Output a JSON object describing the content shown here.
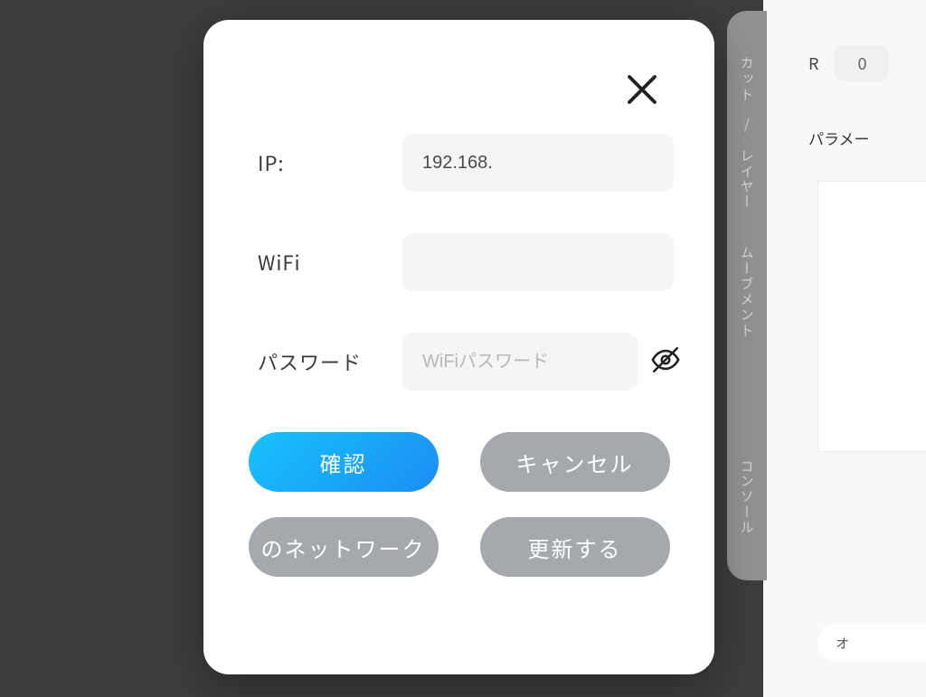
{
  "background": {
    "tabs": [
      "カット / レイヤー",
      "ムーブメント",
      "コンソール"
    ],
    "r_label": "R",
    "r_value": "0",
    "param_label": "パラメー",
    "pill_text": "オ"
  },
  "modal": {
    "fields": {
      "ip": {
        "label": "IP:",
        "value": "192.168.",
        "placeholder": ""
      },
      "wifi": {
        "label": "WiFi",
        "value": "",
        "placeholder": ""
      },
      "password": {
        "label": "パスワード",
        "value": "",
        "placeholder": "WiFiパスワード"
      }
    },
    "buttons": {
      "confirm": "確認",
      "cancel": "キャンセル",
      "network": "のネットワーク",
      "refresh": "更新する"
    }
  }
}
